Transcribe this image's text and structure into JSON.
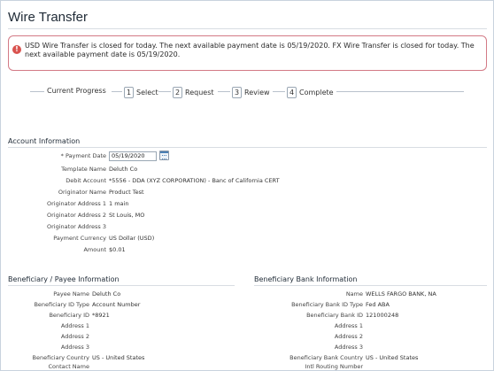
{
  "page": {
    "title": "Wire Transfer"
  },
  "alert": {
    "message": "USD Wire Transfer is closed for today. The next available payment date is 05/19/2020. FX Wire Transfer is closed for today. The next available payment date is 05/19/2020.",
    "icon": "error-icon",
    "border_color": "#d37a86"
  },
  "progress": {
    "label": "Current Progress",
    "steps": [
      {
        "number": "1",
        "label": "Select"
      },
      {
        "number": "2",
        "label": "Request"
      },
      {
        "number": "3",
        "label": "Review"
      },
      {
        "number": "4",
        "label": "Complete"
      }
    ]
  },
  "account": {
    "title": "Account Information",
    "payment_date_label": "* Payment Date",
    "payment_date_value": "05/19/2020",
    "fields": [
      {
        "label": "Template Name",
        "value": "Deluth Co"
      },
      {
        "label": "Debit Account",
        "value": "*5556 - DDA (XYZ CORPORATION) - Banc of California CERT"
      },
      {
        "label": "Originator Name",
        "value": "Product Test"
      },
      {
        "label": "Originator Address 1",
        "value": "1 main"
      },
      {
        "label": "Originator Address 2",
        "value": "St Louis, MO"
      },
      {
        "label": "Originator Address 3",
        "value": ""
      },
      {
        "label": "Payment Currency",
        "value": "US Dollar (USD)"
      },
      {
        "label": "Amount",
        "value": "$0.01"
      }
    ]
  },
  "beneficiary": {
    "title": "Beneficiary / Payee Information",
    "fields": [
      {
        "label": "Payee Name",
        "value": "Deluth Co"
      },
      {
        "label": "Beneficiary ID Type",
        "value": "Account Number"
      },
      {
        "label": "Beneficiary ID",
        "value": "*8921"
      },
      {
        "label": "Address 1",
        "value": ""
      },
      {
        "label": "Address 2",
        "value": ""
      },
      {
        "label": "Address 3",
        "value": ""
      },
      {
        "label": "Beneficiary Country",
        "value": "US  - United States"
      },
      {
        "label": "Contact Name",
        "value": ""
      },
      {
        "label": "Phone Number",
        "value": ""
      }
    ]
  },
  "bank": {
    "title": "Beneficiary Bank Information",
    "fields": [
      {
        "label": "Name",
        "value": "WELLS FARGO BANK, NA"
      },
      {
        "label": "Beneficiary Bank ID Type",
        "value": "Fed ABA"
      },
      {
        "label": "Beneficiary Bank ID",
        "value": "121000248"
      },
      {
        "label": "Address 1",
        "value": ""
      },
      {
        "label": "Address 2",
        "value": ""
      },
      {
        "label": "Address 3",
        "value": ""
      },
      {
        "label": "Beneficiary Bank Country",
        "value": "US  - United States"
      },
      {
        "label": "Intl Routing Number",
        "value": ""
      }
    ]
  }
}
